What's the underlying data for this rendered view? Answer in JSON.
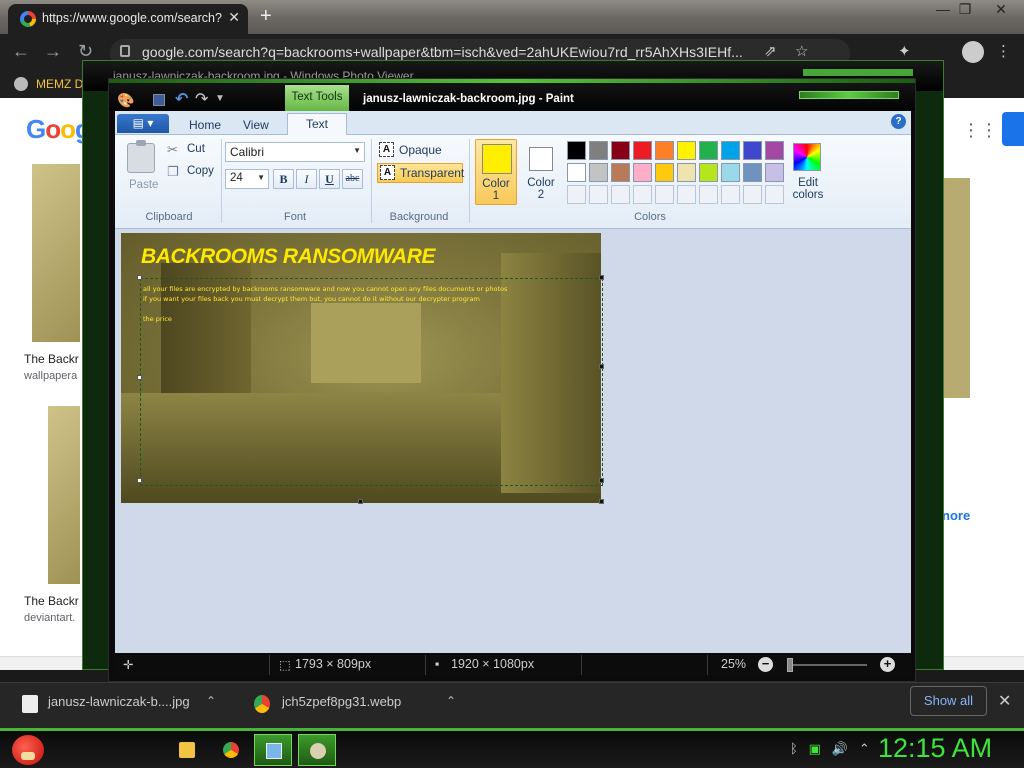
{
  "browser": {
    "tab_title": "https://www.google.com/search?",
    "tab_close": "✕",
    "new_tab": "+",
    "window_controls": [
      "—",
      "❐",
      "✕"
    ],
    "url": "google.com/search?q=backrooms+wallpaper&tbm=isch&ved=2ahUKEwiou7rd_rr5AhXHs3IEHf...",
    "bookmark_label": "MEMZ D",
    "logo_text": [
      "G",
      "o",
      "o",
      "g"
    ],
    "results": [
      {
        "caption": "The Backr",
        "source": "wallpapera"
      },
      {
        "caption": "The Backr",
        "source": "deviantart."
      }
    ],
    "more_label": "nore"
  },
  "photo_viewer": {
    "title": "janusz-lawniczak-backroom.jpg - Windows Photo Viewer"
  },
  "paint": {
    "context_tab": "Text Tools",
    "title": "janusz-lawniczak-backroom.jpg - Paint",
    "tabs": {
      "home": "Home",
      "view": "View",
      "text": "Text"
    },
    "clipboard": {
      "paste": "Paste",
      "cut": "Cut",
      "copy": "Copy",
      "group": "Clipboard"
    },
    "font": {
      "name": "Calibri",
      "size": "24",
      "bold": "B",
      "italic": "I",
      "underline": "U",
      "strike": "abc",
      "group": "Font"
    },
    "background": {
      "opaque": "Opaque",
      "transparent": "Transparent",
      "group": "Background"
    },
    "colors": {
      "color1_label": "Color",
      "color1_num": "1",
      "color2_label": "Color",
      "color2_num": "2",
      "group": "Colors",
      "color1": "#ffee00",
      "color2": "#ffffff",
      "edit_label_1": "Edit",
      "edit_label_2": "colors",
      "palette_row1": [
        "#000000",
        "#7f7f7f",
        "#880015",
        "#ed1c24",
        "#ff7f27",
        "#fff200",
        "#22b14c",
        "#00a2e8",
        "#3f48cc",
        "#a349a4"
      ],
      "palette_row2": [
        "#ffffff",
        "#c3c3c3",
        "#b97a57",
        "#ffaec9",
        "#ffc90e",
        "#efe4b0",
        "#b5e61d",
        "#99d9ea",
        "#7092be",
        "#c8bfe7"
      ]
    },
    "image_text": {
      "title": "BACKROOMS RANSOMWARE",
      "line1": "all your files are encrypted by backrooms ransomware and now you cannot open any files documents or photos",
      "line2": "if you want your files back you must decrypt them but, you cannot do it without our decrypter program",
      "line3": "the price"
    },
    "status": {
      "selection": "1793 × 809px",
      "image_size": "1920 × 1080px",
      "zoom": "25%",
      "zoom_minus": "−",
      "zoom_plus": "+"
    }
  },
  "downloads": {
    "items": [
      "janusz-lawniczak-b....jpg",
      "jch5zpef8pg31.webp"
    ],
    "show_all": "Show all",
    "close": "✕"
  },
  "taskbar": {
    "clock": "12:15 AM"
  }
}
